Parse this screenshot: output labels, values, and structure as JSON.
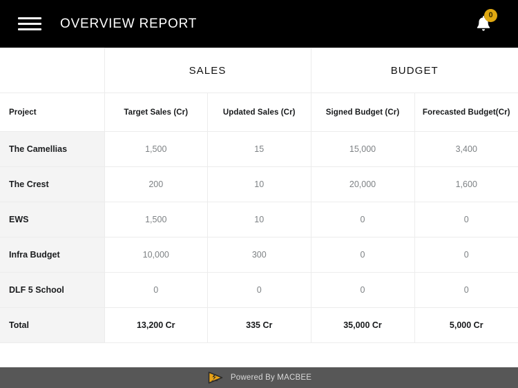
{
  "appbar": {
    "menu_icon": "hamburger-menu-icon",
    "title": "OVERVIEW REPORT",
    "notification_icon": "bell-icon",
    "notification_count": "0",
    "background_color": "#000000",
    "badge_color": "#e0a811"
  },
  "table": {
    "group_headers": [
      {
        "label": "",
        "span": 1
      },
      {
        "label": "SALES",
        "span": 2
      },
      {
        "label": "BUDGET",
        "span": 2
      }
    ],
    "columns": [
      "Project",
      "Target Sales (Cr)",
      "Updated Sales (Cr)",
      "Signed Budget (Cr)",
      "Forecasted Budget(Cr)"
    ],
    "rows": [
      {
        "project": "The Camellias",
        "target_sales": "1,500",
        "updated_sales": "15",
        "signed_budget": "15,000",
        "forecasted_budget": "3,400"
      },
      {
        "project": "The Crest",
        "target_sales": "200",
        "updated_sales": "10",
        "signed_budget": "20,000",
        "forecasted_budget": "1,600"
      },
      {
        "project": "EWS",
        "target_sales": "1,500",
        "updated_sales": "10",
        "signed_budget": "0",
        "forecasted_budget": "0"
      },
      {
        "project": "Infra Budget",
        "target_sales": "10,000",
        "updated_sales": "300",
        "signed_budget": "0",
        "forecasted_budget": "0"
      },
      {
        "project": "DLF 5 School",
        "target_sales": "0",
        "updated_sales": "0",
        "signed_budget": "0",
        "forecasted_budget": "0"
      }
    ],
    "total_row": {
      "project": "Total",
      "target_sales": "13,200 Cr",
      "updated_sales": "335 Cr",
      "signed_budget": "35,000 Cr",
      "forecasted_budget": "5,000 Cr"
    },
    "header_background": "#ffffff",
    "row_header_background": "#f4f4f4",
    "border_color": "#ececec"
  },
  "footer": {
    "logo_icon": "macbee-triangle-logo-icon",
    "text": "Powered By MACBEE",
    "background_color": "#575757",
    "logo_color": "#e8a317"
  }
}
